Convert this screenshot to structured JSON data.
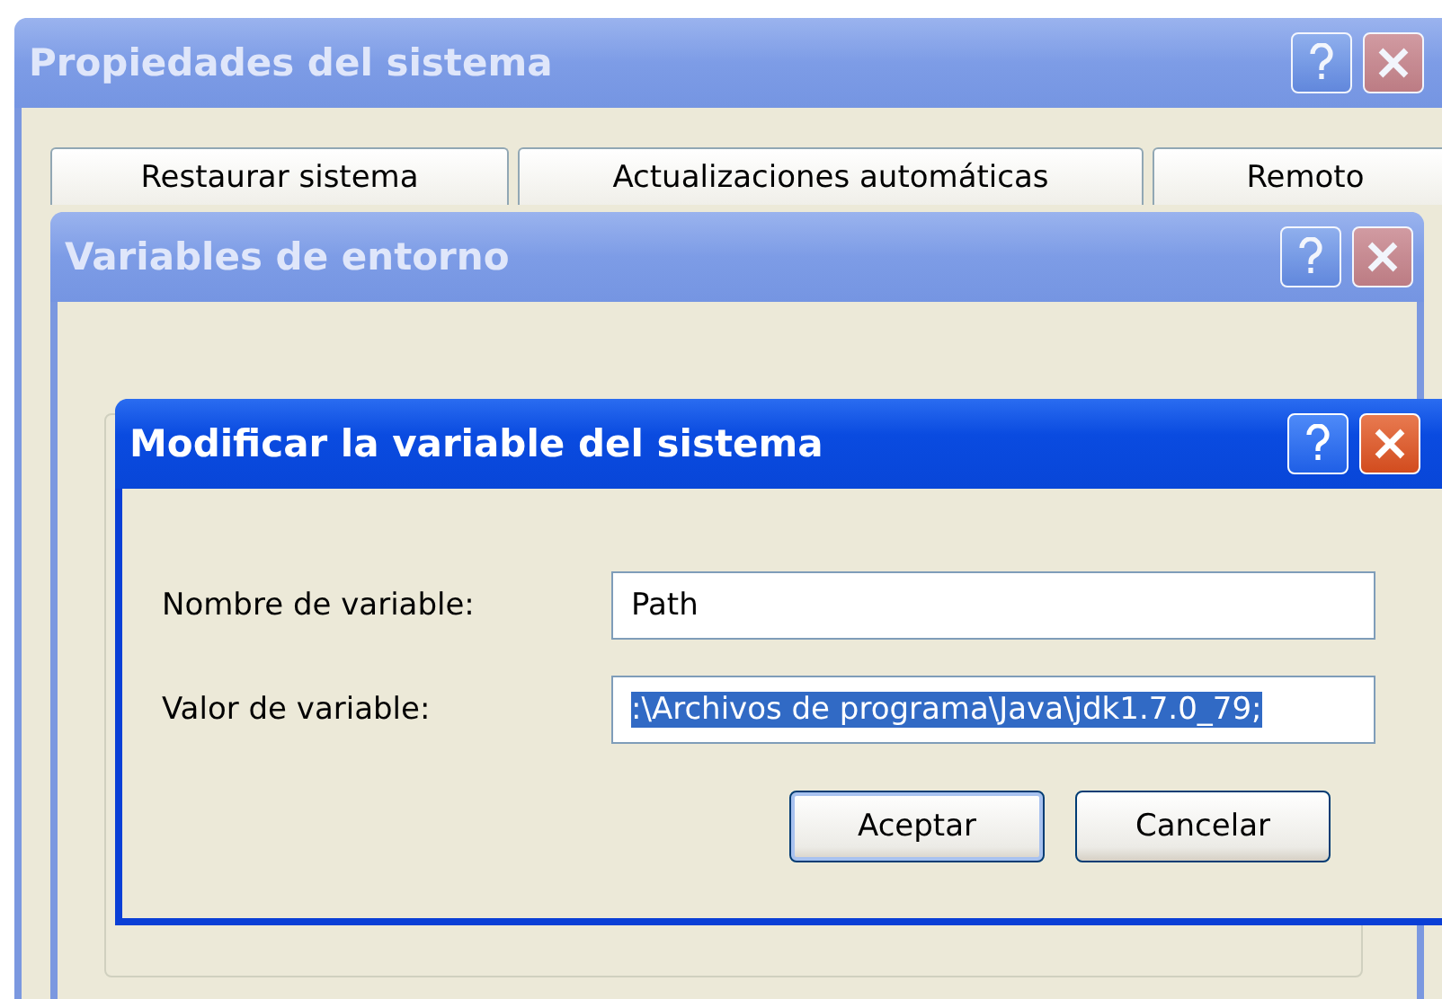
{
  "system_window": {
    "title": "Propiedades del sistema",
    "tabs": [
      {
        "label": "Restaurar sistema"
      },
      {
        "label": "Actualizaciones automáticas"
      },
      {
        "label": "Remoto"
      }
    ]
  },
  "environment_window": {
    "title": "Variables de entorno"
  },
  "edit_dialog": {
    "title": "Modificar la variable del sistema",
    "fields": [
      {
        "label": "Nombre de variable:",
        "value": "Path",
        "highlighted": false
      },
      {
        "label": "Valor de variable:",
        "value": ":\\Archivos de programa\\Java\\jdk1.7.0_79;",
        "highlighted": true
      }
    ],
    "buttons": [
      {
        "label": "Aceptar",
        "default": true
      },
      {
        "label": "Cancelar",
        "default": false
      }
    ]
  }
}
